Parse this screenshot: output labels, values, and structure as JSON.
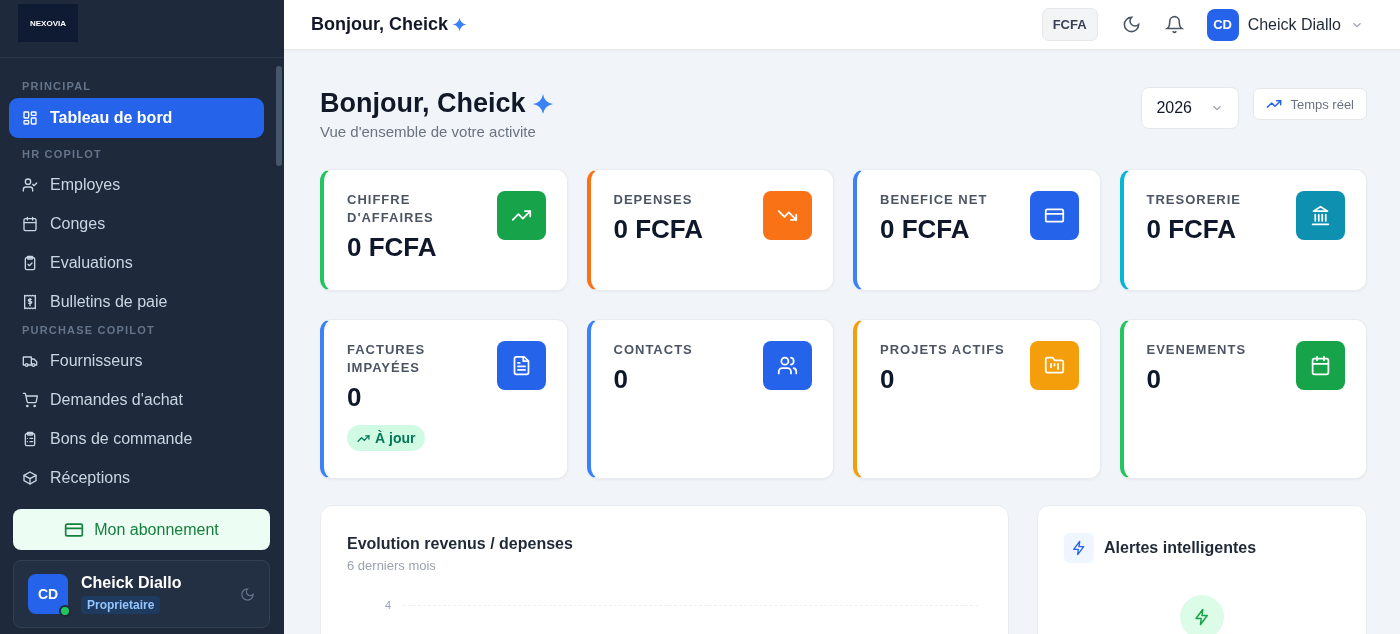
{
  "sidebar": {
    "logo": "NEXOVIA",
    "sections": [
      {
        "title": "PRINCIPAL",
        "items": [
          {
            "label": "Tableau de bord",
            "kind": "grid",
            "selected": true
          }
        ]
      },
      {
        "title": "HR COPILOT",
        "items": [
          {
            "label": "Employes",
            "kind": "user-check",
            "selected": false
          },
          {
            "label": "Conges",
            "kind": "calendar",
            "selected": false
          },
          {
            "label": "Evaluations",
            "kind": "clipboard-check",
            "selected": false
          },
          {
            "label": "Bulletins de paie",
            "kind": "receipt",
            "selected": false
          }
        ]
      },
      {
        "title": "PURCHASE COPILOT",
        "items": [
          {
            "label": "Fournisseurs",
            "kind": "truck",
            "selected": false
          },
          {
            "label": "Demandes d'achat",
            "kind": "cart",
            "selected": false
          },
          {
            "label": "Bons de commande",
            "kind": "clipboard-list",
            "selected": false
          },
          {
            "label": "Réceptions",
            "kind": "box",
            "selected": false
          }
        ]
      }
    ],
    "subscription_button": "Mon abonnement",
    "user": {
      "initials": "CD",
      "name": "Cheick Diallo",
      "role": "Proprietaire",
      "online": true
    }
  },
  "topbar": {
    "greeting": "Bonjour, Cheick",
    "currency": "FCFA",
    "user_initials": "CD",
    "user_name": "Cheick Diallo"
  },
  "header": {
    "title": "Bonjour, Cheick",
    "subtitle": "Vue d'ensemble de votre activite",
    "year": "2026",
    "realtime_button": "Temps réel"
  },
  "kpis": [
    {
      "label": "CHIFFRE D'AFFAIRES",
      "value": "0 FCFA",
      "kind": "trend-up",
      "color": "#16a34a"
    },
    {
      "label": "DEPENSES",
      "value": "0 FCFA",
      "kind": "trend-down",
      "color": "#f97316"
    },
    {
      "label": "BENEFICE NET",
      "value": "0 FCFA",
      "kind": "card",
      "color": "#2563eb"
    },
    {
      "label": "TRESORERIE",
      "value": "0 FCFA",
      "kind": "bank",
      "color": "#0e91b0"
    },
    {
      "label": "FACTURES IMPAYÉES",
      "value": "0",
      "kind": "document",
      "color": "#2563eb",
      "badge": "À jour"
    },
    {
      "label": "CONTACTS",
      "value": "0",
      "kind": "users",
      "color": "#2563eb"
    },
    {
      "label": "PROJETS ACTIFS",
      "value": "0",
      "kind": "folder",
      "color": "#f59e0b"
    },
    {
      "label": "EVENEMENTS",
      "value": "0",
      "kind": "calendar",
      "color": "#16a34a"
    }
  ],
  "revenue_chart": {
    "title": "Evolution revenus / depenses",
    "subtitle": "6 derniers mois",
    "axis_label": "4"
  },
  "alerts": {
    "title": "Alertes intelligentes"
  }
}
